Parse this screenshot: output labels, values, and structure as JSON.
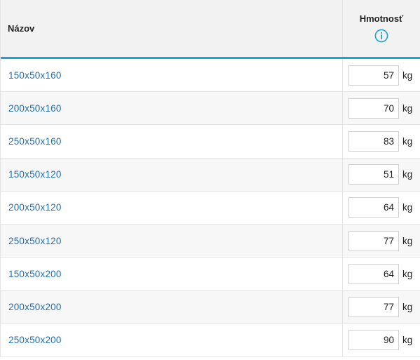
{
  "header": {
    "name_label": "Názov",
    "weight_label": "Hmotnosť",
    "info_icon": "info-circle-icon"
  },
  "colors": {
    "accent": "#1ea0dc",
    "link": "#1f6fb8",
    "header_bg": "#f2f2f2",
    "alt_row_bg": "#f7f7f7"
  },
  "rows": [
    {
      "name": "150x50x160",
      "weight": "57",
      "unit": "kg"
    },
    {
      "name": "200x50x160",
      "weight": "70",
      "unit": "kg"
    },
    {
      "name": "250x50x160",
      "weight": "83",
      "unit": "kg"
    },
    {
      "name": "150x50x120",
      "weight": "51",
      "unit": "kg"
    },
    {
      "name": "200x50x120",
      "weight": "64",
      "unit": "kg"
    },
    {
      "name": "250x50x120",
      "weight": "77",
      "unit": "kg"
    },
    {
      "name": "150x50x200",
      "weight": "64",
      "unit": "kg"
    },
    {
      "name": "200x50x200",
      "weight": "77",
      "unit": "kg"
    },
    {
      "name": "250x50x200",
      "weight": "90",
      "unit": "kg"
    }
  ]
}
